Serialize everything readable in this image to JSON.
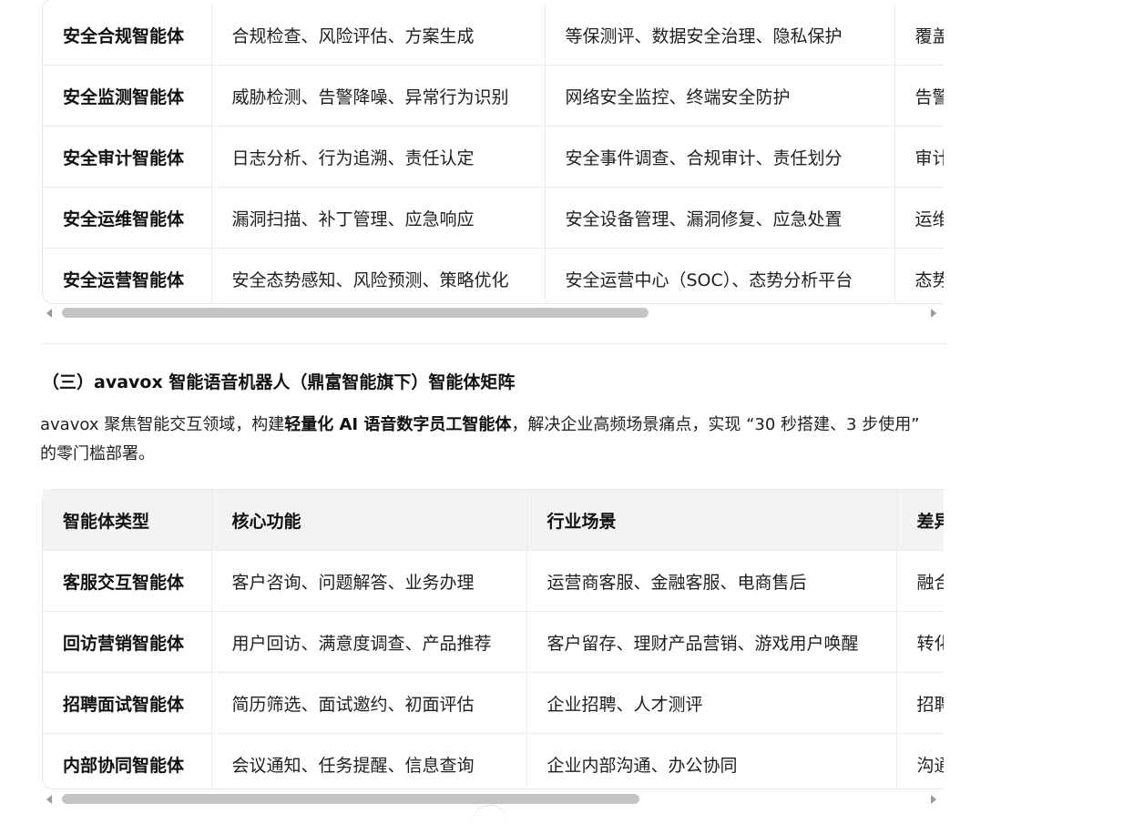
{
  "table1": {
    "rows": [
      [
        "安全合规智能体",
        "合规检查、风险评估、方案生成",
        "等保测评、数据安全治理、隐私保护",
        "覆盖"
      ],
      [
        "安全监测智能体",
        "威胁检测、告警降噪、异常行为识别",
        "网络安全监控、终端安全防护",
        "告警"
      ],
      [
        "安全审计智能体",
        "日志分析、行为追溯、责任认定",
        "安全事件调查、合规审计、责任划分",
        "审计"
      ],
      [
        "安全运维智能体",
        "漏洞扫描、补丁管理、应急响应",
        "安全设备管理、漏洞修复、应急处置",
        "运维"
      ],
      [
        "安全运营智能体",
        "安全态势感知、风险预测、策略优化",
        "安全运营中心（SOC）、态势分析平台",
        "态势"
      ]
    ]
  },
  "section": {
    "heading": "（三）avavox 智能语音机器人（鼎富智能旗下）智能体矩阵",
    "intro_before": "avavox 聚焦智能交互领域，构建",
    "intro_bold": "轻量化 AI 语音数字员工智能体",
    "intro_after": "，解决企业高频场景痛点，实现 “30 秒搭建、3 步使用” 的零门槛部署。"
  },
  "table2": {
    "headers": [
      "智能体类型",
      "核心功能",
      "行业场景",
      "差异"
    ],
    "rows": [
      [
        "客服交互智能体",
        "客户咨询、问题解答、业务办理",
        "运营商客服、金融客服、电商售后",
        "融合"
      ],
      [
        "回访营销智能体",
        "用户回访、满意度调查、产品推荐",
        "客户留存、理财产品营销、游戏用户唤醒",
        "转化"
      ],
      [
        "招聘面试智能体",
        "简历筛选、面试邀约、初面评估",
        "企业招聘、人才测评",
        "招聘"
      ],
      [
        "内部协同智能体",
        "会议通知、任务提醒、信息查询",
        "企业内部沟通、办公协同",
        "沟通"
      ]
    ]
  },
  "colors": {
    "border": "#ececec",
    "header_bg": "#f3f3f3",
    "scroll_thumb": "#c4c4c4"
  }
}
